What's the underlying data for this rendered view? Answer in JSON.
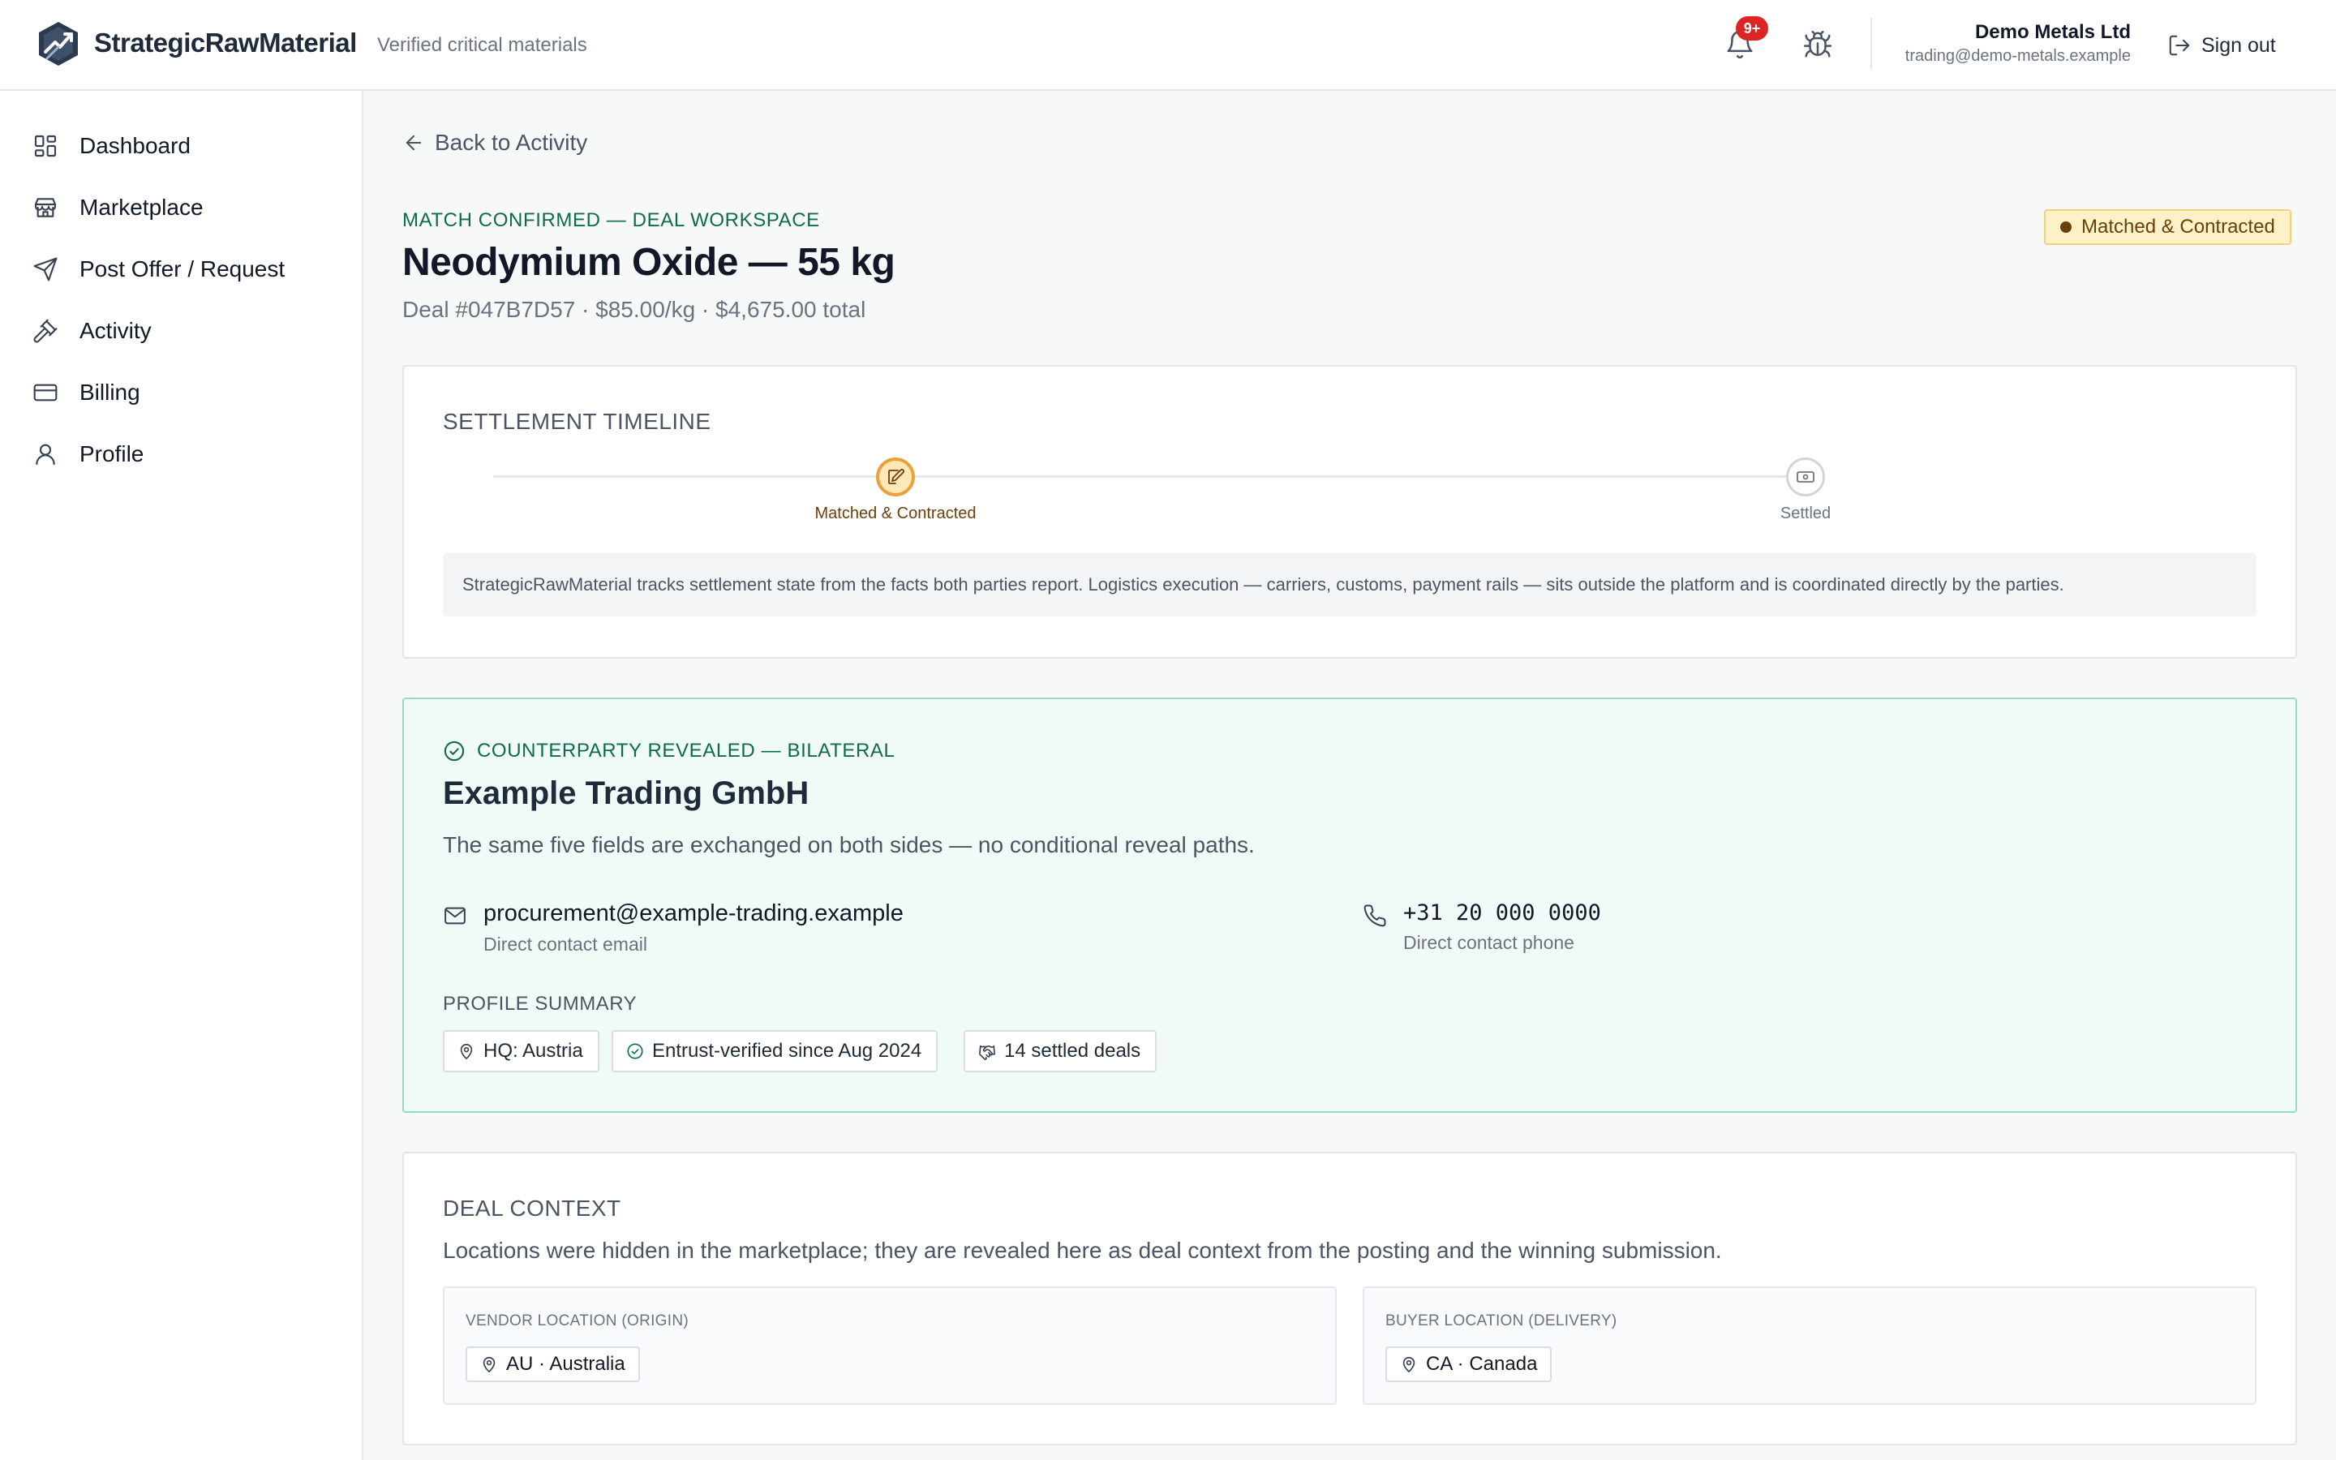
{
  "header": {
    "brand": "StrategicRawMaterial",
    "tagline": "Verified critical materials",
    "notifications_badge": "9+",
    "org_name": "Demo Metals Ltd",
    "org_email": "trading@demo-metals.example",
    "signout_label": "Sign out",
    "icons": [
      "logo-icon",
      "bell-icon",
      "bug-icon",
      "sign-out-icon"
    ]
  },
  "sidebar": {
    "items": [
      {
        "label": "Dashboard",
        "icon": "dashboard-icon"
      },
      {
        "label": "Marketplace",
        "icon": "store-icon"
      },
      {
        "label": "Post Offer / Request",
        "icon": "send-icon"
      },
      {
        "label": "Activity",
        "icon": "gavel-icon"
      },
      {
        "label": "Billing",
        "icon": "credit-card-icon"
      },
      {
        "label": "Profile",
        "icon": "user-icon"
      }
    ]
  },
  "main": {
    "back_label": "Back to Activity",
    "eyebrow": "MATCH CONFIRMED — DEAL WORKSPACE",
    "title": "Neodymium Oxide — 55 kg",
    "subtitle": "Deal #047B7D57 · $85.00/kg · $4,675.00 total",
    "status_badge": "Matched & Contracted",
    "status_color": "#6b3f0c"
  },
  "timeline": {
    "title": "SETTLEMENT TIMELINE",
    "steps": [
      {
        "label": "Matched & Contracted",
        "state": "active",
        "icon": "edit-icon"
      },
      {
        "label": "Settled",
        "state": "pending",
        "icon": "cash-icon"
      }
    ],
    "note": "StrategicRawMaterial tracks settlement state from the facts both parties report. Logistics execution — carriers, customs, payment rails — sits outside the platform and is coordinated directly by the parties."
  },
  "counterparty": {
    "eyebrow": "COUNTERPARTY REVEALED — BILATERAL",
    "name": "Example Trading GmbH",
    "description": "The same five fields are exchanged on both sides — no conditional reveal paths.",
    "email": {
      "value": "procurement@example-trading.example",
      "label": "Direct contact email"
    },
    "phone": {
      "value": "+31 20 000 0000",
      "label": "Direct contact phone"
    },
    "profile_summary_title": "PROFILE SUMMARY",
    "chips": [
      {
        "label": "HQ: Austria",
        "icon": "map-pin-icon"
      },
      {
        "label": "Entrust-verified since Aug 2024",
        "icon": "check-circle-icon"
      },
      {
        "label": "14 settled deals",
        "icon": "handshake-icon"
      }
    ],
    "accent": "#0f6b4f"
  },
  "deal_context": {
    "title": "DEAL CONTEXT",
    "description": "Locations were hidden in the marketplace; they are revealed here as deal context from the posting and the winning submission.",
    "vendor": {
      "label": "VENDOR LOCATION (ORIGIN)",
      "value": "AU · Australia"
    },
    "buyer": {
      "label": "BUYER LOCATION (DELIVERY)",
      "value": "CA · Canada"
    }
  }
}
